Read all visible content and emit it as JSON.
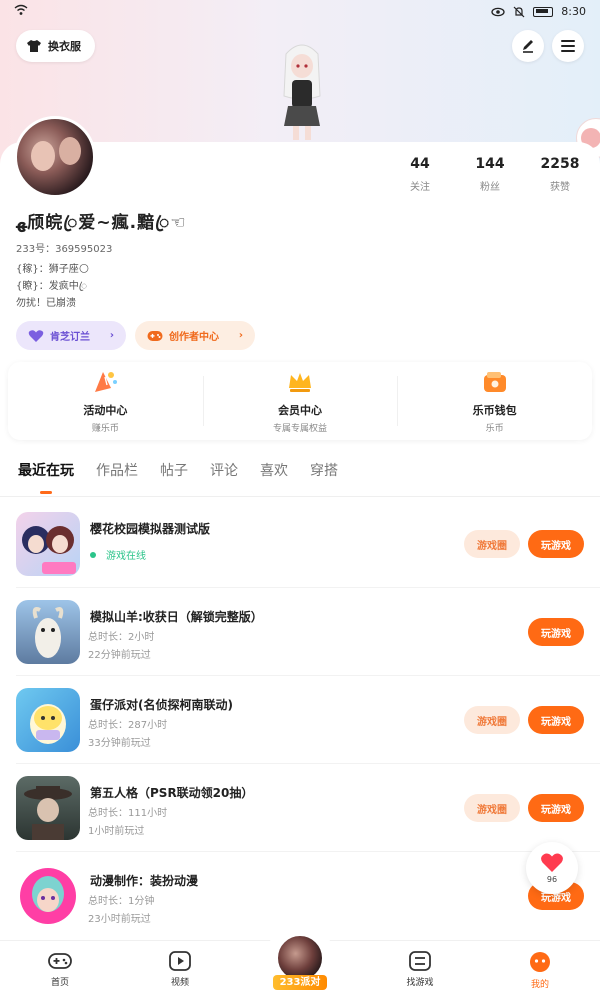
{
  "status_bar": {
    "time": "8:30"
  },
  "header": {
    "outfit_button": "换衣服"
  },
  "profile": {
    "stats": [
      {
        "value": "44",
        "label": "关注"
      },
      {
        "value": "144",
        "label": "粉丝"
      },
      {
        "value": "2258",
        "label": "获赞"
      }
    ],
    "nickname": "ﻬ颀皖ꦿ爱~瘋.黯ꦿ☜",
    "uid": "233号：369595023",
    "bio": [
      "{稼}：狮子座🌕",
      "{瞭}：发疯中ꦿ",
      "勿扰！已崩溃"
    ],
    "pills": [
      {
        "label": "肯芝订兰",
        "icon": "heart-icon"
      },
      {
        "label": "创作者中心",
        "icon": "gamepad-icon"
      }
    ]
  },
  "quick_links": [
    {
      "title": "活动中心",
      "subtitle": "赚乐币",
      "icon": "party-icon"
    },
    {
      "title": "会员中心",
      "subtitle": "专属专属权益",
      "icon": "crown-icon"
    },
    {
      "title": "乐币钱包",
      "subtitle": "乐币",
      "icon": "wallet-icon"
    }
  ],
  "tabs": [
    "最近在玩",
    "作品栏",
    "帖子",
    "评论",
    "喜欢",
    "穿搭"
  ],
  "games": [
    {
      "title": "樱花校园模拟器测试版",
      "status": "游戏在线",
      "circle_button": "游戏圈",
      "play_button": "玩游戏"
    },
    {
      "title": "模拟山羊:收获日（解锁完整版）",
      "playtime": "总时长：2小时",
      "last_played": "22分钟前玩过",
      "play_button": "玩游戏"
    },
    {
      "title": "蛋仔派对(名侦探柯南联动)",
      "playtime": "总时长：287小时",
      "last_played": "33分钟前玩过",
      "circle_button": "游戏圈",
      "play_button": "玩游戏"
    },
    {
      "title": "第五人格（PSR联动领20抽）",
      "playtime": "总时长：111小时",
      "last_played": "1小时前玩过",
      "circle_button": "游戏圈",
      "play_button": "玩游戏"
    },
    {
      "title": "动漫制作：装扮动漫",
      "playtime": "总时长：1分钟",
      "last_played": "23小时前玩过",
      "play_button": "玩游戏"
    }
  ],
  "like_fab": {
    "count": "96"
  },
  "bottom_nav": [
    {
      "label": "首页",
      "icon": "gamepad-icon"
    },
    {
      "label": "视频",
      "icon": "play-icon"
    },
    {
      "label": "233派对",
      "icon": "avatar"
    },
    {
      "label": "找游戏",
      "icon": "list-icon"
    },
    {
      "label": "我的",
      "icon": "face-icon",
      "active": true
    }
  ],
  "colors": {
    "accent": "#ff6a14",
    "online": "#2bc48a",
    "purple": "#6a4fd3"
  }
}
